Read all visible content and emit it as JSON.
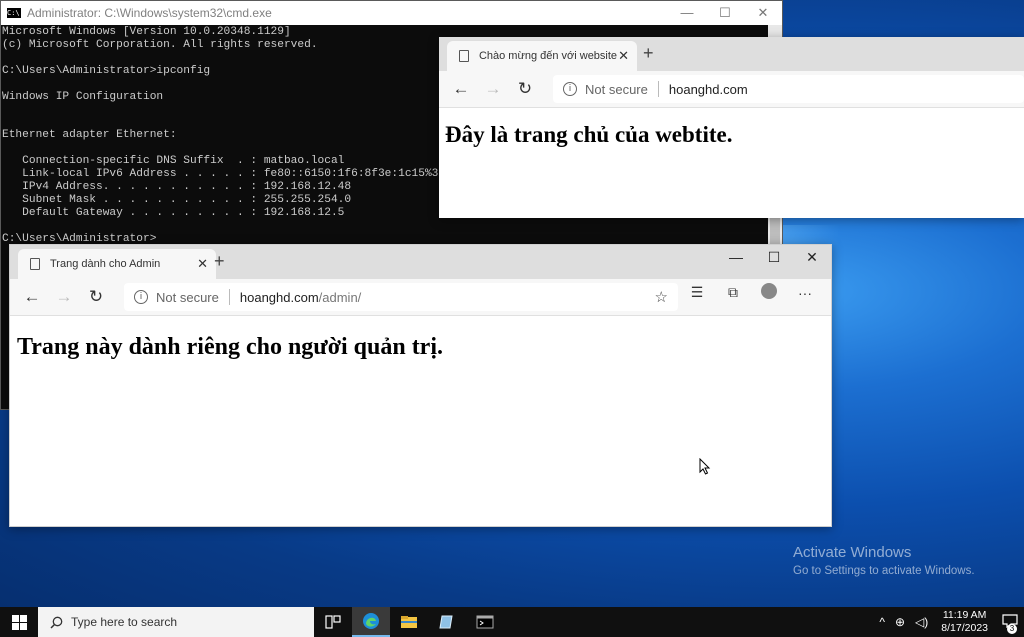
{
  "cmd": {
    "title": "Administrator: C:\\Windows\\system32\\cmd.exe",
    "icon_text": "C:\\",
    "controls": {
      "minimize": "—",
      "maximize": "☐",
      "close": "✕"
    },
    "output": "Microsoft Windows [Version 10.0.20348.1129]\n(c) Microsoft Corporation. All rights reserved.\n\nC:\\Users\\Administrator>ipconfig\n\nWindows IP Configuration\n\n\nEthernet adapter Ethernet:\n\n   Connection-specific DNS Suffix  . : matbao.local\n   Link-local IPv6 Address . . . . . : fe80::6150:1f6:8f3e:1c15%3\n   IPv4 Address. . . . . . . . . . . : 192.168.12.48\n   Subnet Mask . . . . . . . . . . . : 255.255.254.0\n   Default Gateway . . . . . . . . . : 192.168.12.5\n\nC:\\Users\\Administrator>"
  },
  "browser_home": {
    "tab_title": "Chào mừng đến với website của",
    "url_status": "Not secure",
    "url_host": "hoanghd.com",
    "url_path": "",
    "heading": "Đây là trang chủ của webtite."
  },
  "browser_admin": {
    "tab_title": "Trang dành cho Admin",
    "url_status": "Not secure",
    "url_host": "hoanghd.com",
    "url_path": "/admin/",
    "heading": "Trang này dành riêng cho người quản trị."
  },
  "icons": {
    "back": "←",
    "forward": "→",
    "refresh": "↻",
    "info": "i",
    "close": "✕",
    "new_tab": "+",
    "minimize": "—",
    "maximize": "☐",
    "favorite": "☆",
    "favorites_list": "☰",
    "collections": "⧉",
    "more": "···"
  },
  "activation": {
    "title": "Activate Windows",
    "subtitle": "Go to Settings to activate Windows."
  },
  "taskbar": {
    "search_placeholder": "Type here to search",
    "time": "11:19 AM",
    "date": "8/17/2023",
    "notifications_count": "3",
    "tray_chevron": "^",
    "network_icon": "⊕",
    "volume_icon": "◁)"
  }
}
